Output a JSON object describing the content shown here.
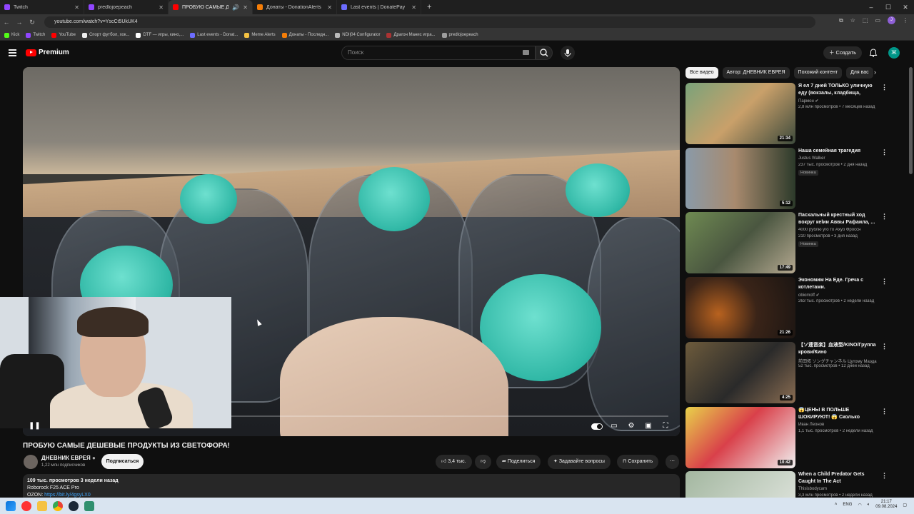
{
  "browser": {
    "tabs": [
      {
        "title": "Twitch",
        "color": "#9146ff",
        "active": false
      },
      {
        "title": "predlojoepeach",
        "color": "#9146ff",
        "active": false
      },
      {
        "title": "ПРОБУЮ САМЫЕ ДЕШЕВЫ",
        "color": "#ff0000",
        "active": true
      },
      {
        "title": "Донаты - DonationAlerts",
        "color": "#f57d07",
        "active": false
      },
      {
        "title": "Last events | DonatePay",
        "color": "#6c6cff",
        "active": false
      }
    ],
    "url": "youtube.com/watch?v=YscCt5UkUK4",
    "bookmarks": [
      "Kick",
      "Twitch",
      "YouTube",
      "Спорт футбол, хок...",
      "DTF — игры, кино,...",
      "Last events - Donat...",
      "Meme Alerts",
      "Донаты - Последн...",
      "NDI|04 Configurator",
      "Драгон Манис игра...",
      "predlojoepeach"
    ],
    "profile_initial": "J"
  },
  "youtube": {
    "logo_text": "Premium",
    "search_placeholder": "Поиск",
    "create_label": "Создать",
    "avatar_initial": "Ж"
  },
  "video": {
    "title": "ПРОБУЮ САМЫЕ ДЕШЕВЫЕ ПРОДУКТЫ ИЗ СВЕТОФОРА!",
    "channel": "ДНЕВНИК ЕВРЕЯ",
    "subscribers": "1,22 млн подписчиков",
    "subscribe_label": "Подписаться",
    "likes": "3,4 тыс.",
    "share_label": "Поделиться",
    "ask_label": "Задавайте вопросы",
    "save_label": "Сохранить",
    "description": {
      "meta": "109 тыс. просмотров  3 недели назад",
      "line1": "Roborock F25 ACE Pro",
      "line2_prefix": "OZON: ",
      "line2_link": "https://bit.ly/4gsyLX0"
    }
  },
  "sidebar": {
    "chips": [
      "Все видео",
      "Автор: ДНЕВНИК ЕВРЕЯ",
      "Похожий контент",
      "Для вас"
    ],
    "recommendations": [
      {
        "title": "Я ел 7 дней ТОЛЬКО уличную еду (вокзалы, кладбища, рынки)",
        "channel": "Пармон ✔",
        "meta": "2,8 млн просмотров • 7 месяцев назад",
        "duration": "21:34",
        "badge": ""
      },
      {
        "title": "Наша семейная трагедия",
        "channel": "Justus Walker",
        "meta": "237 тыс. просмотров • 2 дня назад",
        "duration": "5:12",
        "badge": "Новинка"
      },
      {
        "title": "Пасхальный крестный ход вокруг кelии Аввы Рафаила, ...",
        "channel": "",
        "meta": "4000 рублю уго то Ахуо Фроссн",
        "meta2": "210 просмотров • 3 дня назад",
        "duration": "17:49",
        "badge": "Новинка"
      },
      {
        "title": "Экономим На Еде. Греча с котлетами.",
        "channel": "obiomoff ✔",
        "meta": "263 тыс. просмотров • 2 недели назад",
        "duration": "21:26",
        "badge": ""
      },
      {
        "title": "【ソ連音楽】血液型/KINO/Группа крови/Кино",
        "channel": "前田拓 ソングチャンネル  Цутому Маэда",
        "meta": "52 тыс. просмотров • 12 дней назад",
        "duration": "4:25",
        "badge": ""
      },
      {
        "title": "😱ЦЕНЫ В ПОЛЬШЕ ШОКИРУЮТ! 😱 Сколько стоит...",
        "channel": "Иван Леонов",
        "meta": "1,1 тыс. просмотров • 2 недели назад",
        "duration": "10:42",
        "badge": ""
      },
      {
        "title": "When a Child Predator Gets Caught In The Act",
        "channel": "Thisisbodycam",
        "meta": "3,3 млн просмотров • 2 недели назад",
        "duration": "",
        "badge": ""
      }
    ]
  },
  "taskbar": {
    "lang": "ENG",
    "time": "21:17",
    "date": "09.08.2024"
  }
}
